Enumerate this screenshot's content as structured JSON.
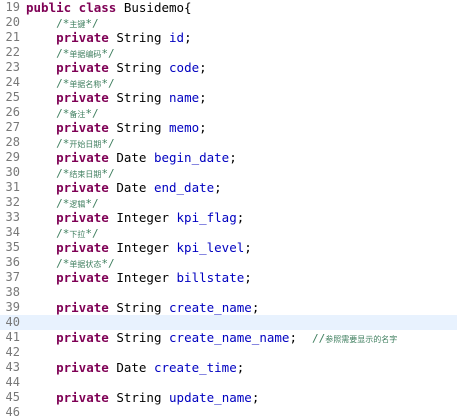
{
  "colors": {
    "keyword": "#7f0055",
    "field": "#0000c0",
    "comment": "#3f7f5f",
    "line_number": "#787878",
    "current_line": "#e8f2fe"
  },
  "lines": [
    {
      "num": "19",
      "indent": "",
      "tokens": [
        {
          "t": "kw",
          "v": "public class"
        },
        {
          "t": "plain",
          "v": " Busidemo{"
        }
      ]
    },
    {
      "num": "20",
      "indent": "    ",
      "tokens": [
        {
          "t": "cm",
          "v": "/*"
        },
        {
          "t": "cms",
          "v": "主键"
        },
        {
          "t": "cm",
          "v": "*/"
        }
      ]
    },
    {
      "num": "21",
      "indent": "    ",
      "tokens": [
        {
          "t": "kw",
          "v": "private"
        },
        {
          "t": "plain",
          "v": " String "
        },
        {
          "t": "fld",
          "v": "id"
        },
        {
          "t": "plain",
          "v": ";"
        }
      ]
    },
    {
      "num": "22",
      "indent": "    ",
      "tokens": [
        {
          "t": "cm",
          "v": "/*"
        },
        {
          "t": "cms",
          "v": "单据编码"
        },
        {
          "t": "cm",
          "v": "*/"
        }
      ]
    },
    {
      "num": "23",
      "indent": "    ",
      "tokens": [
        {
          "t": "kw",
          "v": "private"
        },
        {
          "t": "plain",
          "v": " String "
        },
        {
          "t": "fld",
          "v": "code"
        },
        {
          "t": "plain",
          "v": ";"
        }
      ]
    },
    {
      "num": "24",
      "indent": "    ",
      "tokens": [
        {
          "t": "cm",
          "v": "/*"
        },
        {
          "t": "cms",
          "v": "单据名称"
        },
        {
          "t": "cm",
          "v": "*/"
        }
      ]
    },
    {
      "num": "25",
      "indent": "    ",
      "tokens": [
        {
          "t": "kw",
          "v": "private"
        },
        {
          "t": "plain",
          "v": " String "
        },
        {
          "t": "fld",
          "v": "name"
        },
        {
          "t": "plain",
          "v": ";"
        }
      ]
    },
    {
      "num": "26",
      "indent": "    ",
      "tokens": [
        {
          "t": "cm",
          "v": "/*"
        },
        {
          "t": "cms",
          "v": "备注"
        },
        {
          "t": "cm",
          "v": "*/"
        }
      ]
    },
    {
      "num": "27",
      "indent": "    ",
      "tokens": [
        {
          "t": "kw",
          "v": "private"
        },
        {
          "t": "plain",
          "v": " String "
        },
        {
          "t": "fld",
          "v": "memo"
        },
        {
          "t": "plain",
          "v": ";"
        }
      ]
    },
    {
      "num": "28",
      "indent": "    ",
      "tokens": [
        {
          "t": "cm",
          "v": "/*"
        },
        {
          "t": "cms",
          "v": "开始日期"
        },
        {
          "t": "cm",
          "v": "*/"
        }
      ]
    },
    {
      "num": "29",
      "indent": "    ",
      "tokens": [
        {
          "t": "kw",
          "v": "private"
        },
        {
          "t": "plain",
          "v": " Date "
        },
        {
          "t": "fld",
          "v": "begin_date"
        },
        {
          "t": "plain",
          "v": ";"
        }
      ]
    },
    {
      "num": "30",
      "indent": "    ",
      "tokens": [
        {
          "t": "cm",
          "v": "/*"
        },
        {
          "t": "cms",
          "v": "结束日期"
        },
        {
          "t": "cm",
          "v": "*/"
        }
      ]
    },
    {
      "num": "31",
      "indent": "    ",
      "tokens": [
        {
          "t": "kw",
          "v": "private"
        },
        {
          "t": "plain",
          "v": " Date "
        },
        {
          "t": "fld",
          "v": "end_date"
        },
        {
          "t": "plain",
          "v": ";"
        }
      ]
    },
    {
      "num": "32",
      "indent": "    ",
      "tokens": [
        {
          "t": "cm",
          "v": "/*"
        },
        {
          "t": "cms",
          "v": "逻辑"
        },
        {
          "t": "cm",
          "v": "*/"
        }
      ]
    },
    {
      "num": "33",
      "indent": "    ",
      "tokens": [
        {
          "t": "kw",
          "v": "private"
        },
        {
          "t": "plain",
          "v": " Integer "
        },
        {
          "t": "fld",
          "v": "kpi_flag"
        },
        {
          "t": "plain",
          "v": ";"
        }
      ]
    },
    {
      "num": "34",
      "indent": "    ",
      "tokens": [
        {
          "t": "cm",
          "v": "/*"
        },
        {
          "t": "cms",
          "v": "下拉"
        },
        {
          "t": "cm",
          "v": "*/"
        }
      ]
    },
    {
      "num": "35",
      "indent": "    ",
      "tokens": [
        {
          "t": "kw",
          "v": "private"
        },
        {
          "t": "plain",
          "v": " Integer "
        },
        {
          "t": "fld",
          "v": "kpi_level"
        },
        {
          "t": "plain",
          "v": ";"
        }
      ]
    },
    {
      "num": "36",
      "indent": "    ",
      "tokens": [
        {
          "t": "cm",
          "v": "/*"
        },
        {
          "t": "cms",
          "v": "单据状态"
        },
        {
          "t": "cm",
          "v": "*/"
        }
      ]
    },
    {
      "num": "37",
      "indent": "    ",
      "tokens": [
        {
          "t": "kw",
          "v": "private"
        },
        {
          "t": "plain",
          "v": " Integer "
        },
        {
          "t": "fld",
          "v": "billstate"
        },
        {
          "t": "plain",
          "v": ";"
        }
      ]
    },
    {
      "num": "38",
      "indent": "",
      "tokens": []
    },
    {
      "num": "39",
      "indent": "    ",
      "tokens": [
        {
          "t": "kw",
          "v": "private"
        },
        {
          "t": "plain",
          "v": " String "
        },
        {
          "t": "fld",
          "v": "create_name"
        },
        {
          "t": "plain",
          "v": ";"
        }
      ]
    },
    {
      "num": "40",
      "indent": "",
      "tokens": [],
      "current": true
    },
    {
      "num": "41",
      "indent": "    ",
      "tokens": [
        {
          "t": "kw",
          "v": "private"
        },
        {
          "t": "plain",
          "v": " String "
        },
        {
          "t": "fld",
          "v": "create_name_name"
        },
        {
          "t": "plain",
          "v": ";  "
        },
        {
          "t": "cm",
          "v": "//"
        },
        {
          "t": "cms",
          "v": "参照需要显示的名字"
        }
      ]
    },
    {
      "num": "42",
      "indent": "",
      "tokens": []
    },
    {
      "num": "43",
      "indent": "    ",
      "tokens": [
        {
          "t": "kw",
          "v": "private"
        },
        {
          "t": "plain",
          "v": " Date "
        },
        {
          "t": "fld",
          "v": "create_time"
        },
        {
          "t": "plain",
          "v": ";"
        }
      ]
    },
    {
      "num": "44",
      "indent": "",
      "tokens": []
    },
    {
      "num": "45",
      "indent": "    ",
      "tokens": [
        {
          "t": "kw",
          "v": "private"
        },
        {
          "t": "plain",
          "v": " String "
        },
        {
          "t": "fld",
          "v": "update_name"
        },
        {
          "t": "plain",
          "v": ";"
        }
      ]
    },
    {
      "num": "46",
      "indent": "",
      "tokens": []
    }
  ]
}
